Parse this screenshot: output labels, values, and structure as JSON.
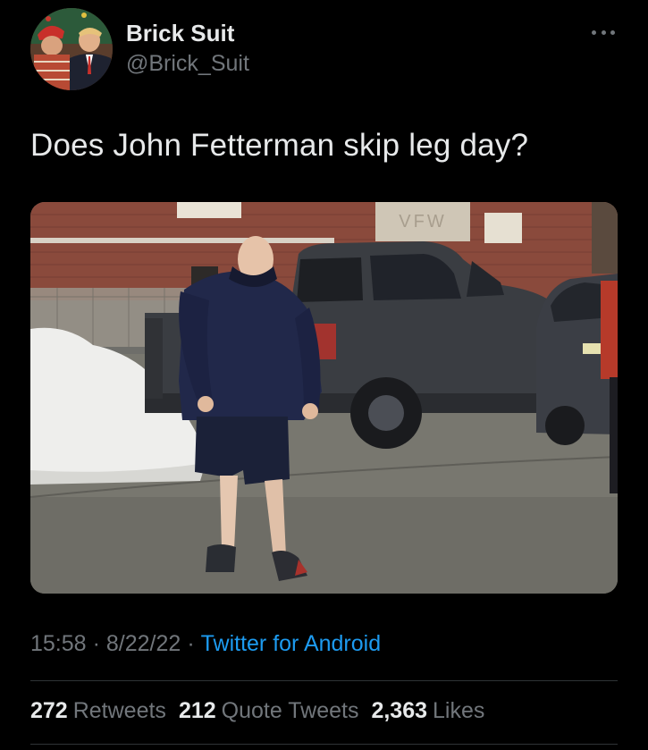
{
  "author": {
    "display_name": "Brick Suit",
    "handle": "@Brick_Suit"
  },
  "tweet": {
    "text": "Does John Fetterman skip leg day?"
  },
  "meta": {
    "time": "15:58",
    "separator": "·",
    "date": "8/22/22",
    "source": "Twitter for Android"
  },
  "stats": {
    "retweets_count": "272",
    "retweets_label": "Retweets",
    "quotes_count": "212",
    "quotes_label": "Quote Tweets",
    "likes_count": "2,363",
    "likes_label": "Likes"
  },
  "photo": {
    "sign_text": "VFW"
  },
  "colors": {
    "background": "#000000",
    "text_primary": "#e7e9ea",
    "text_secondary": "#71767b",
    "link": "#1d9bf0",
    "divider": "#2f3336"
  },
  "icons": {
    "more": "more-horizontal-icon"
  }
}
